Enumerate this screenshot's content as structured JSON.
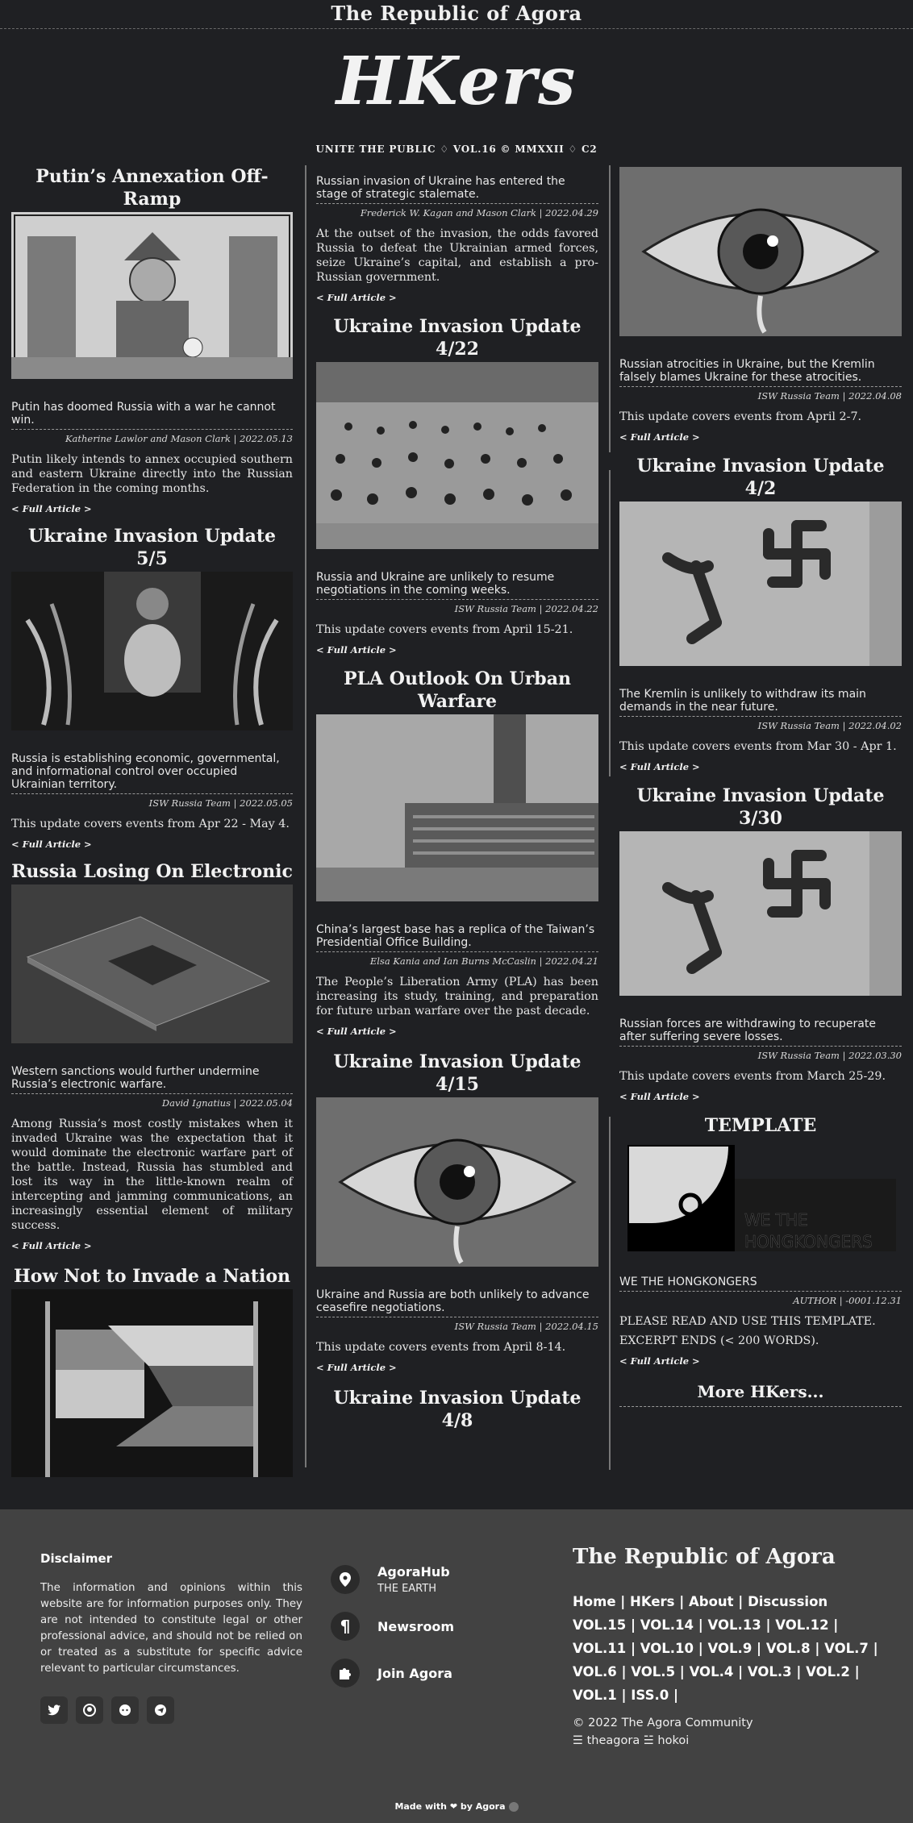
{
  "topbar": {
    "title": "The Republic of Agora"
  },
  "masthead": {
    "logo": "HKers",
    "tagline": "UNITE THE PUBLIC ♢ VOL.16 © MMXXII ♢ C2"
  },
  "read_more": "< Full Article >",
  "col1": [
    {
      "title": "Putin’s Annexation Off-Ramp",
      "lead": "Putin has doomed Russia with a war he cannot win.",
      "byline": "Katherine Lawlor and Mason Clark | 2022.05.13",
      "body": "Putin likely intends to annex occupied southern and eastern Ukraine directly into the Russian Federation in the coming months."
    },
    {
      "title": "Ukraine Invasion Update 5/5",
      "lead": "Russia is establishing economic, governmental, and informational control over occupied Ukrainian territory.",
      "byline": "ISW Russia Team | 2022.05.05",
      "body": "This update covers events from Apr 22 - May 4."
    },
    {
      "title": "Russia Losing On Electronic",
      "lead": "Western sanctions would further undermine Russia’s electronic warfare.",
      "byline": "David Ignatius | 2022.05.04",
      "body": "Among Russia’s most costly mistakes when it invaded Ukraine was the expectation that it would dominate the electronic warfare part of the battle. Instead, Russia has stumbled and lost its way in the little-known realm of intercepting and jamming communications, an increasingly essential element of military success."
    },
    {
      "title": "How Not to Invade a Nation"
    }
  ],
  "col2": [
    {
      "lead": "Russian invasion of Ukraine has entered the stage of strategic stalemate.",
      "byline": "Frederick W. Kagan and Mason Clark | 2022.04.29",
      "body": "At the outset of the invasion, the odds favored Russia to defeat the Ukrainian armed forces, seize Ukraine’s capital, and establish a pro-Russian government."
    },
    {
      "title": "Ukraine Invasion Update 4/22",
      "lead": "Russia and Ukraine are unlikely to resume negotiations in the coming weeks.",
      "byline": "ISW Russia Team | 2022.04.22",
      "body": "This update covers events from April 15-21."
    },
    {
      "title": "PLA Outlook On Urban Warfare",
      "lead": "China’s largest base has a replica of the Taiwan’s Presidential Office Building.",
      "byline": "Elsa Kania and Ian Burns McCaslin | 2022.04.21",
      "body": "The People’s Liberation Army (PLA) has been increasing its study, training, and preparation for future urban warfare over the past decade."
    },
    {
      "title": "Ukraine Invasion Update 4/15",
      "lead": "Ukraine and Russia are both unlikely to advance ceasefire negotiations.",
      "byline": "ISW Russia Team | 2022.04.15",
      "body": "This update covers events from April 8-14."
    },
    {
      "title": "Ukraine Invasion Update 4/8"
    }
  ],
  "col3": [
    {
      "lead": "Russian atrocities in Ukraine, but the Kremlin falsely blames Ukraine for these atrocities.",
      "byline": "ISW Russia Team | 2022.04.08",
      "body": "This update covers events from April 2-7."
    },
    {
      "title": "Ukraine Invasion Update 4/2",
      "lead": "The Kremlin is unlikely to withdraw its main demands in the near future.",
      "byline": "ISW Russia Team | 2022.04.02",
      "body": "This update covers events from Mar 30 - Apr 1."
    },
    {
      "title": "Ukraine Invasion Update 3/30",
      "lead": "Russian forces are withdrawing to recuperate after suffering severe losses.",
      "byline": "ISW Russia Team | 2022.03.30",
      "body": "This update covers events from March 25-29."
    },
    {
      "title": "TEMPLATE",
      "image_text_1": "WE THE",
      "image_text_2": "HONGKONGERS",
      "lead": "WE THE HONGKONGERS",
      "byline": "AUTHOR | -0001.12.31",
      "body": "PLEASE READ AND USE THIS TEMPLATE.",
      "body2": "EXCERPT ENDS (< 200 WORDS)."
    }
  ],
  "more_hkers": "More HKers...",
  "footer": {
    "disclaimer_title": "Disclaimer",
    "disclaimer_text": "The information and opinions within this website are for information purposes only. They are not intended to constitute legal or other professional advice, and should not be relied on or treated as a substitute for specific advice relevant to particular circumstances.",
    "agorahub": "AgoraHub",
    "agorahub_sub": "THE EARTH",
    "newsroom": "Newsroom",
    "join": "Join Agora",
    "republic": "The Republic of Agora",
    "nav_line1": "Home | HKers | About | Discussion",
    "nav_line2": "VOL.15  |  VOL.14  |  VOL.13  |  VOL.12  |",
    "nav_line3": "VOL.11 | VOL.10 | VOL.9 | VOL.8 | VOL.7 |",
    "nav_line4": "VOL.6  |  VOL.5  |  VOL.4  |  VOL.3  |  VOL.2  |",
    "nav_line5": "VOL.1 | ISS.0 |",
    "copyright": "© 2022 The Agora Community",
    "handles": "☰ theagora ☱ hokoi",
    "made_with": "Made with ❤ by Agora"
  }
}
